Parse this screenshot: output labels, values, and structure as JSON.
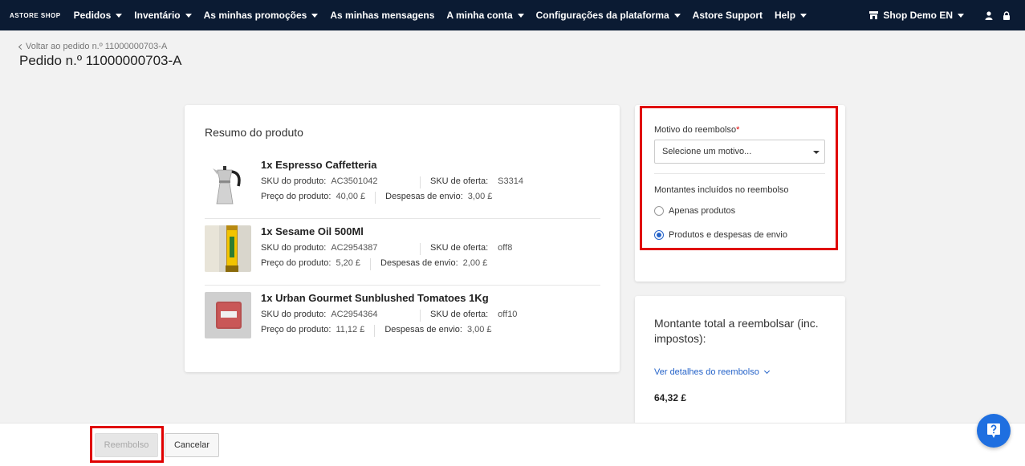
{
  "nav": {
    "logo": "ASTORE SHOP",
    "items": [
      {
        "label": "Pedidos",
        "dropdown": true
      },
      {
        "label": "Inventário",
        "dropdown": true
      },
      {
        "label": "As minhas promoções",
        "dropdown": true
      },
      {
        "label": "As minhas mensagens",
        "dropdown": false
      },
      {
        "label": "A minha conta",
        "dropdown": true
      },
      {
        "label": "Configurações da plataforma",
        "dropdown": true
      },
      {
        "label": "Astore Support",
        "dropdown": false
      },
      {
        "label": "Help",
        "dropdown": true
      }
    ],
    "shop_selector": "Shop Demo EN",
    "right_icons": [
      "store-icon",
      "user-icon",
      "lock-icon"
    ]
  },
  "header": {
    "back_link": "Voltar ao pedido n.º 11000000703-A",
    "title": "Pedido n.º 11000000703-A"
  },
  "summary": {
    "title": "Resumo do produto",
    "labels": {
      "sku_product": "SKU do produto:",
      "sku_offer": "SKU de oferta:",
      "price": "Preço do produto:",
      "shipping": "Despesas de envio:"
    },
    "products": [
      {
        "name": "1x Espresso Caffetteria",
        "sku_product": "AC3501042",
        "sku_offer": "S3314",
        "price": "40,00 £",
        "shipping": "3,00 £",
        "thumb_icon": "moka-pot-image"
      },
      {
        "name": "1x Sesame Oil 500Ml",
        "sku_product": "AC2954387",
        "sku_offer": "off8",
        "price": "5,20 £",
        "shipping": "2,00 £",
        "thumb_icon": "oil-bottle-image"
      },
      {
        "name": "1x Urban Gourmet Sunblushed Tomatoes 1Kg",
        "sku_product": "AC2954364",
        "sku_offer": "off10",
        "price": "11,12 £",
        "shipping": "3,00 £",
        "thumb_icon": "tomatoes-pack-image"
      }
    ]
  },
  "refund_form": {
    "reason_label": "Motivo do reembolso",
    "required_mark": "*",
    "reason_placeholder": "Selecione um motivo...",
    "amounts_label": "Montantes incluídos no reembolso",
    "options": [
      {
        "label": "Apenas produtos",
        "checked": false
      },
      {
        "label": "Produtos e despesas de envio",
        "checked": true
      }
    ]
  },
  "total": {
    "label": "Montante total a reembolsar (inc. impostos):",
    "details_link": "Ver detalhes do reembolso",
    "value": "64,32 £"
  },
  "actions": {
    "refund": "Reembolso",
    "cancel": "Cancelar"
  },
  "colors": {
    "nav_bg": "#0b1b33",
    "accent": "#2563c9",
    "highlight": "#e00000",
    "fab": "#1f6fe0"
  }
}
